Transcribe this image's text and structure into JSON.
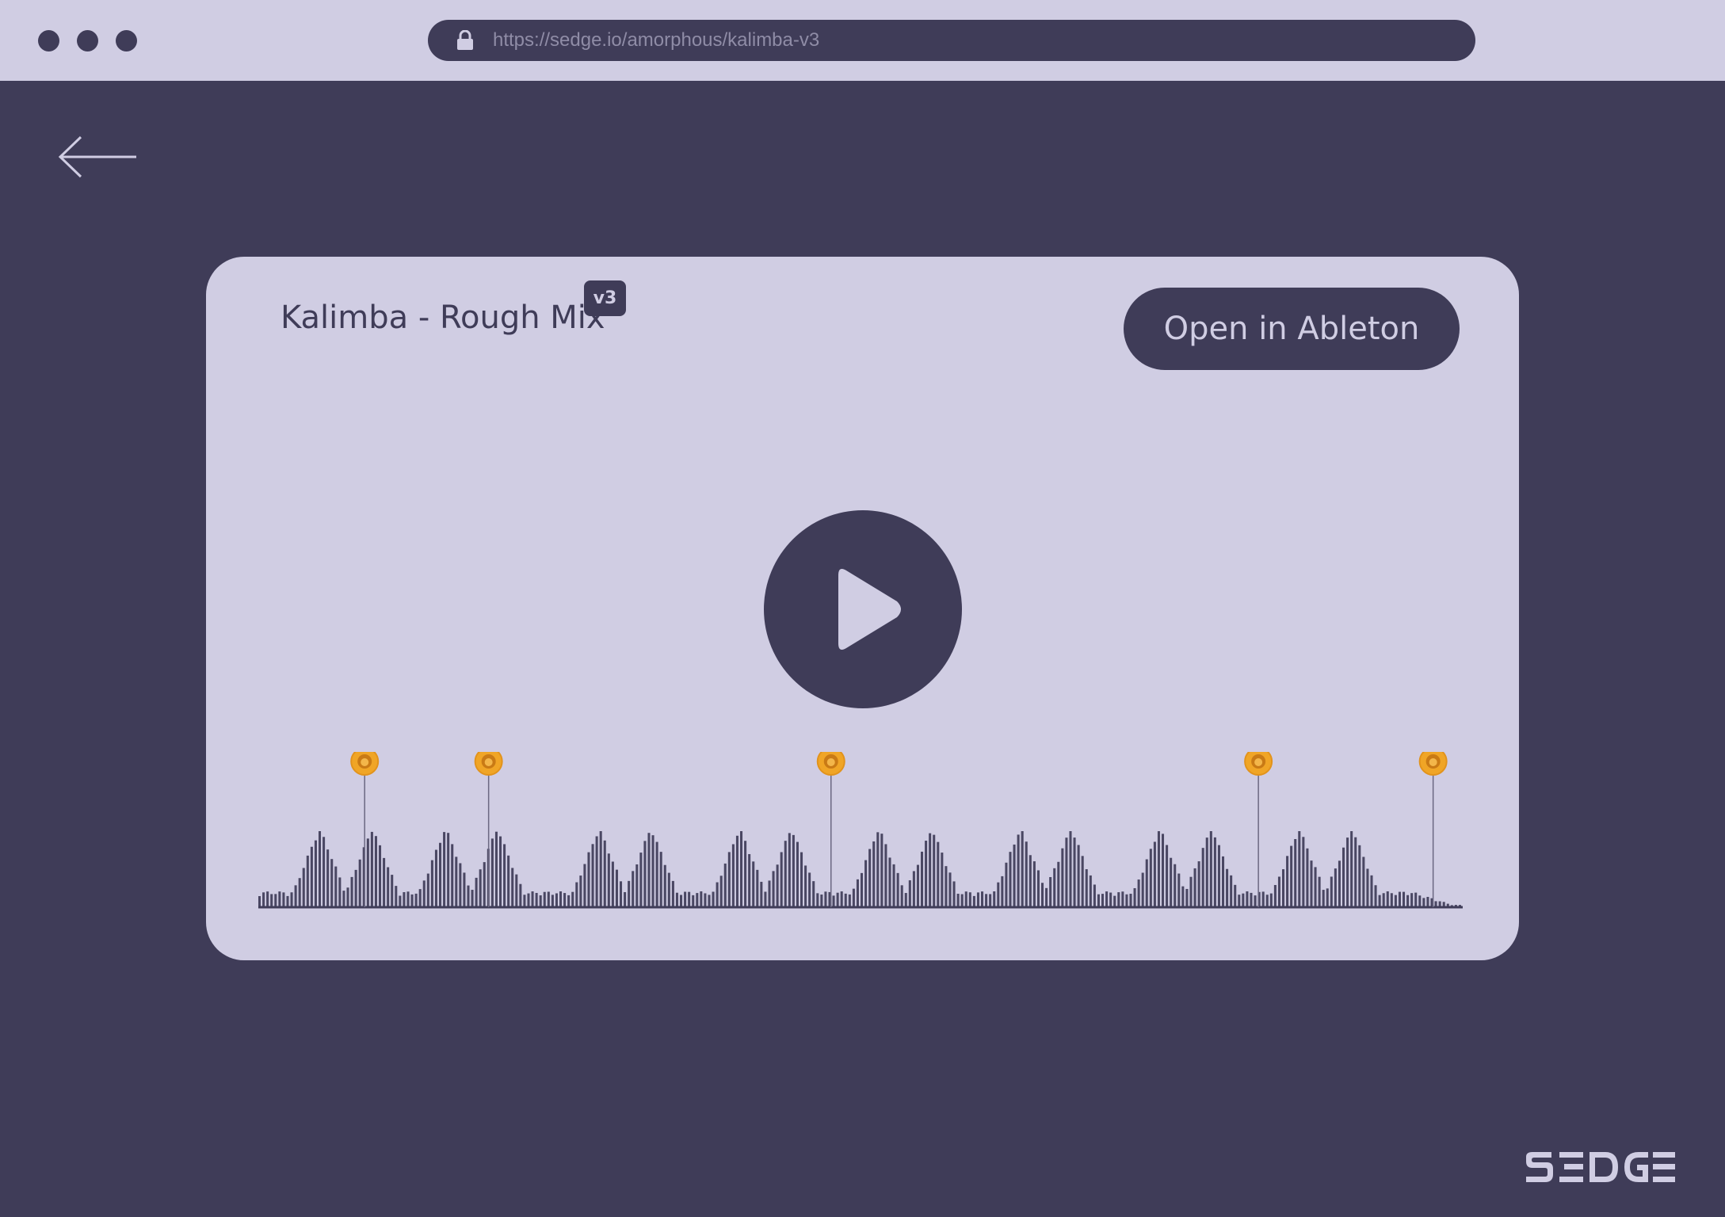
{
  "browser": {
    "url": "https://sedge.io/amorphous/kalimba-v3",
    "window_controls": [
      "close-dot",
      "minimize-dot",
      "maximize-dot"
    ]
  },
  "nav": {
    "back_icon": "arrow-left-icon"
  },
  "track": {
    "title": "Kalimba - Rough Mix",
    "version": "v3",
    "open_button_label": "Open in Ableton",
    "play_icon": "play-icon"
  },
  "waveform": {
    "comment_marker_icon": "lion-avatar-icon",
    "comment_marker_count": 5,
    "comment_positions": [
      0.08,
      0.185,
      0.475,
      0.837,
      0.985
    ]
  },
  "brand": {
    "logo": "SEDGE"
  },
  "colors": {
    "background": "#3f3c58",
    "surface": "#d0cde3",
    "url_text": "#8f8ca6",
    "marker": "#f0a526"
  }
}
